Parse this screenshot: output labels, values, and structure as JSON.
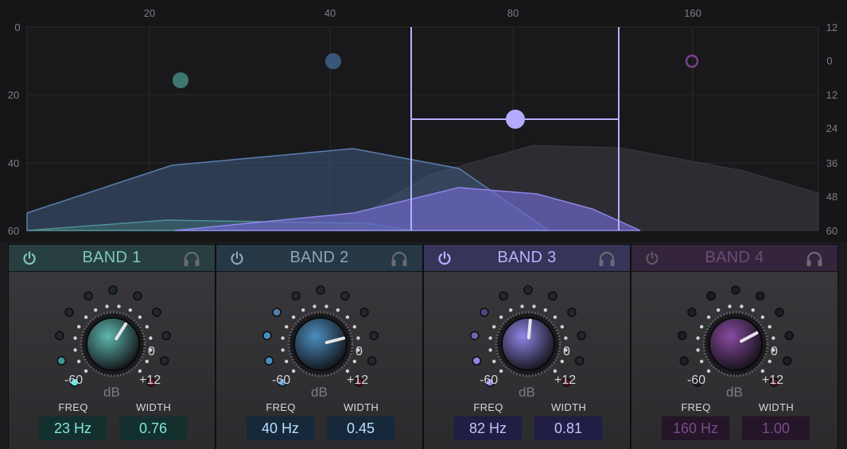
{
  "analyzer": {
    "freq_ticks": [
      "20",
      "40",
      "80",
      "160"
    ],
    "left_ticks": [
      "0",
      "20",
      "40",
      "60"
    ],
    "right_ticks": [
      "12",
      "0",
      "12",
      "24",
      "36",
      "48",
      "60"
    ]
  },
  "bands": [
    {
      "title": "BAND 1",
      "color": "#5fb7ae",
      "header_bg": "#27403f",
      "value_color": "#7fe8dc",
      "value_bg": "#14302e",
      "title_color": "#7fc7bf",
      "gain_level": 0.62,
      "freq_label": "FREQ",
      "width_label": "WIDTH",
      "freq": "23 Hz",
      "width": "0.76",
      "scale_min": "-60",
      "scale_zero": "0",
      "scale_max": "+12",
      "unit": "dB",
      "enabled": true
    },
    {
      "title": "BAND 2",
      "color": "#4c8ec0",
      "header_bg": "#263746",
      "value_color": "#b5e0ff",
      "value_bg": "#16283a",
      "title_color": "#8aa6bd",
      "gain_level": 0.78,
      "freq_label": "FREQ",
      "width_label": "WIDTH",
      "freq": "40 Hz",
      "width": "0.45",
      "scale_min": "-60",
      "scale_zero": "0",
      "scale_max": "+12",
      "unit": "dB",
      "enabled": true
    },
    {
      "title": "BAND 3",
      "color": "#8f86e6",
      "header_bg": "#363458",
      "value_color": "#c8c2ff",
      "value_bg": "#201e44",
      "title_color": "#b8b2ff",
      "gain_level": 0.52,
      "freq_label": "FREQ",
      "width_label": "WIDTH",
      "freq": "82 Hz",
      "width": "0.81",
      "scale_min": "-60",
      "scale_zero": "0",
      "scale_max": "+12",
      "unit": "dB",
      "enabled": true
    },
    {
      "title": "BAND 4",
      "color": "#8a4aa0",
      "header_bg": "#34243c",
      "value_color": "#7c4a8c",
      "value_bg": "#241528",
      "title_color": "#6d4a7a",
      "gain_level": 0.73,
      "freq_label": "FREQ",
      "width_label": "WIDTH",
      "freq": "160 Hz",
      "width": "1.00",
      "scale_min": "-60",
      "scale_zero": "0",
      "scale_max": "+12",
      "unit": "dB",
      "enabled": false
    }
  ]
}
